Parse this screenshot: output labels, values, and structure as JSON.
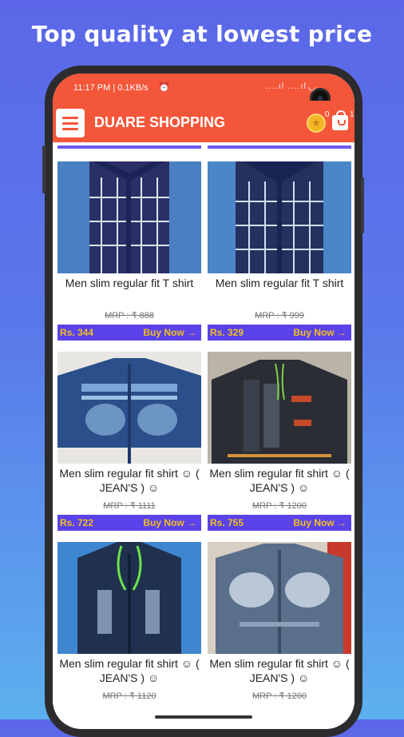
{
  "headline": "Top quality at lowest price",
  "status_bar": {
    "time_text": "11:17 PM | 0.1KB/s",
    "alarm_icon": "alarm-icon",
    "signal_text": "....ıl ....ıl"
  },
  "app_bar": {
    "title": "DUARE SHOPPING",
    "menu_icon": "hamburger-icon",
    "coin_count": "0",
    "cart_count": "1"
  },
  "colors": {
    "accent": "#f4563a",
    "price_bar": "#5a43ea",
    "price_text": "#f0c020"
  },
  "products": [
    {
      "name": "Men slim regular fit T shirt",
      "mrp": "MRP : ₹ 888",
      "price": "Rs. 344",
      "buy_label": "Buy Now →"
    },
    {
      "name": "Men slim regular fit T shirt",
      "mrp": "MRP : ₹ 999",
      "price": "Rs. 329",
      "buy_label": "Buy Now →"
    },
    {
      "name": "Men slim regular fit shirt ☺ ( JEAN'S ) ☺",
      "mrp": "MRP : ₹ 1111",
      "price": "Rs. 722",
      "buy_label": "Buy Now →"
    },
    {
      "name": "Men slim regular fit shirt ☺ ( JEAN'S ) ☺",
      "mrp": "MRP : ₹ 1200",
      "price": "Rs. 755",
      "buy_label": "Buy Now →"
    },
    {
      "name": "Men slim regular fit shirt ☺ ( JEAN'S ) ☺",
      "mrp": "MRP : ₹ 1120",
      "price": "",
      "buy_label": ""
    },
    {
      "name": "Men slim regular fit shirt ☺ ( JEAN'S ) ☺",
      "mrp": "MRP : ₹ 1200",
      "price": "",
      "buy_label": ""
    }
  ]
}
